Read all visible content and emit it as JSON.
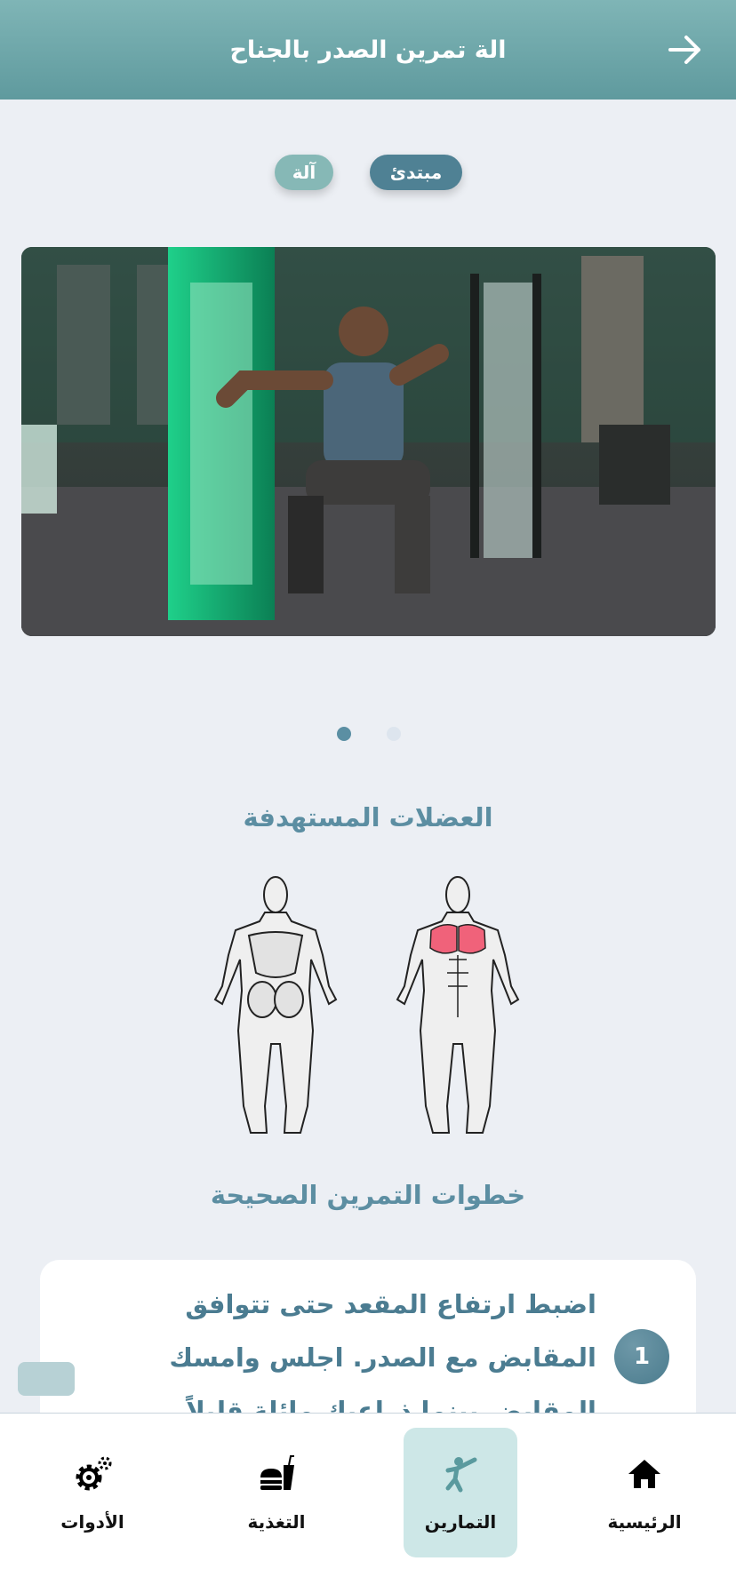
{
  "header": {
    "title": "الة تمرين الصدر بالجناح"
  },
  "tags": {
    "level": "مبتدئ",
    "equipment": "آلة"
  },
  "carousel": {
    "page_count": 2,
    "active_page": 1
  },
  "sections": {
    "muscles_title": "العضلات المستهدفة",
    "steps_title": "خطوات التمرين الصحيحة"
  },
  "steps": [
    {
      "number": "1",
      "text": "اضبط ارتفاع المقعد حتى تتوافق المقابض مع الصدر. اجلس وامسك المقابض بينما ذراعيك مائلة قليلاً"
    }
  ],
  "bottom_nav": {
    "items": [
      {
        "label": "الرئيسية",
        "icon": "home-icon"
      },
      {
        "label": "التمارين",
        "icon": "martial-arts-icon",
        "active": true
      },
      {
        "label": "التغذية",
        "icon": "food-icon"
      },
      {
        "label": "الأدوات",
        "icon": "gear-icon"
      }
    ]
  },
  "colors": {
    "header": "#6FA8AB",
    "accent": "#5C8EA2",
    "highlight_muscle": "#F0627A",
    "nav_active_bg": "#CDE7E7"
  }
}
